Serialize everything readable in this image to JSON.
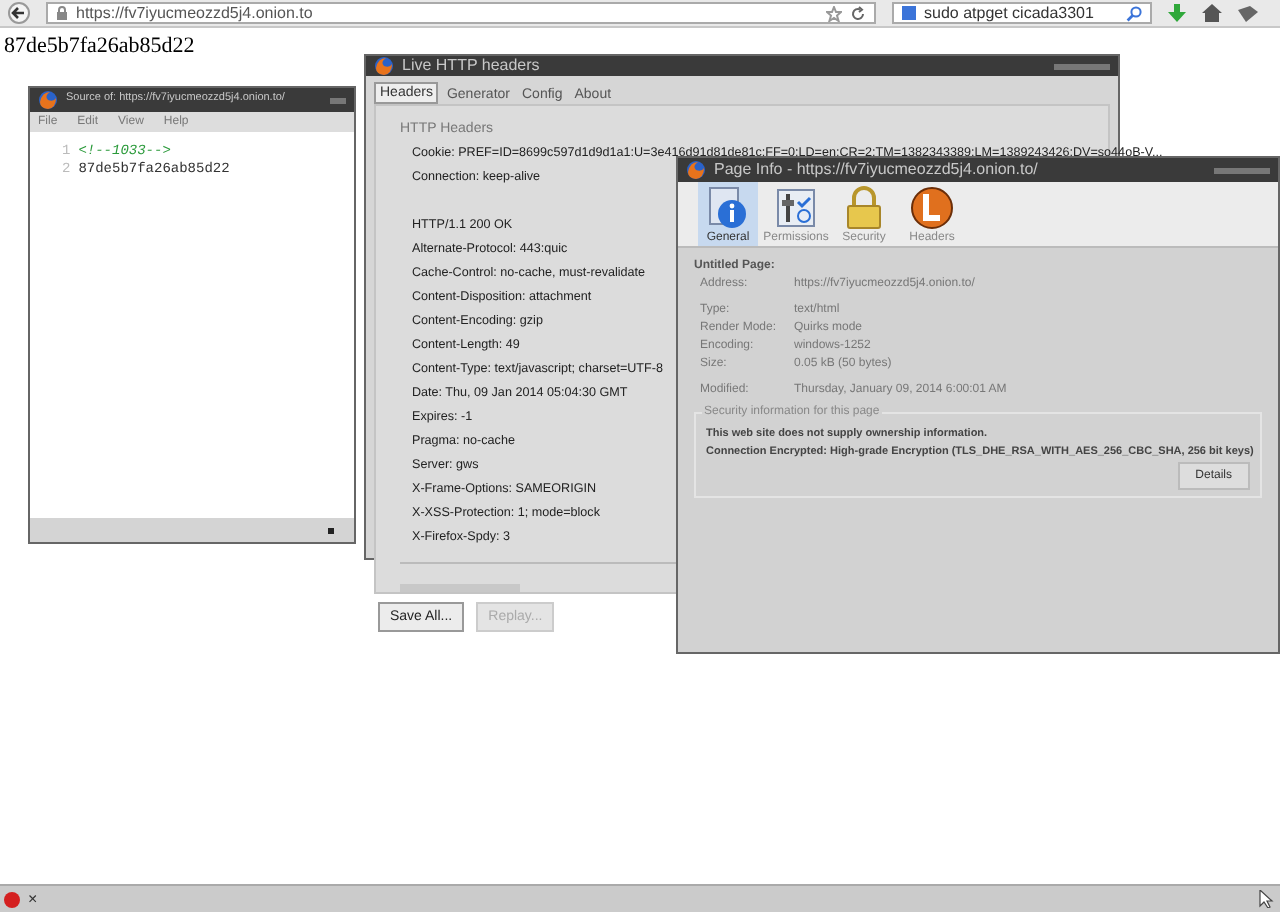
{
  "browser": {
    "url": "https://fv7iyucmeozzd5j4.onion.to",
    "search": "sudo atpget cicada3301"
  },
  "page_text": "87de5b7fa26ab85d22",
  "source_window": {
    "title": "Source of: https://fv7iyucmeozzd5j4.onion.to/",
    "menu": [
      "File",
      "Edit",
      "View",
      "Help"
    ],
    "lines": [
      {
        "number": "1",
        "text": "<!--1033-->",
        "kind": "comment"
      },
      {
        "number": "2",
        "text": "87de5b7fa26ab85d22",
        "kind": "text"
      }
    ]
  },
  "headers_window": {
    "title": "Live HTTP headers",
    "tabs": [
      {
        "label": "Headers",
        "selected": true
      },
      {
        "label": "Generator",
        "selected": false
      },
      {
        "label": "Config",
        "selected": false
      },
      {
        "label": "About",
        "selected": false
      }
    ],
    "section": "HTTP Headers",
    "lines": [
      {
        "text": "Cookie: PREF=ID=8699c597d1d9d1a1:U=3e416d91d81de81c:FF=0:LD=en:CR=2:TM=1382343389:LM=1389243426:DV=so44oB-V...",
        "kind": "request"
      },
      {
        "text": "Connection: keep-alive",
        "kind": "request"
      },
      {
        "text": "HTTP/1.1 200 OK",
        "kind": "status"
      },
      {
        "text": "Alternate-Protocol: 443:quic",
        "kind": "response"
      },
      {
        "text": "Cache-Control: no-cache, must-revalidate",
        "kind": "response"
      },
      {
        "text": "Content-Disposition: attachment",
        "kind": "response"
      },
      {
        "text": "Content-Encoding: gzip",
        "kind": "response"
      },
      {
        "text": "Content-Length: 49",
        "kind": "response"
      },
      {
        "text": "Content-Type: text/javascript; charset=UTF-8",
        "kind": "response"
      },
      {
        "text": "Date: Thu, 09 Jan 2014 05:04:30 GMT",
        "kind": "response"
      },
      {
        "text": "Expires: -1",
        "kind": "response"
      },
      {
        "text": "Pragma: no-cache",
        "kind": "response"
      },
      {
        "text": "Server: gws",
        "kind": "response"
      },
      {
        "text": "X-Frame-Options: SAMEORIGIN",
        "kind": "response"
      },
      {
        "text": "X-XSS-Protection: 1; mode=block",
        "kind": "response"
      },
      {
        "text": "X-Firefox-Spdy: 3",
        "kind": "response"
      }
    ],
    "buttons": [
      {
        "label": "Save All...",
        "disabled": false
      },
      {
        "label": "Replay...",
        "disabled": true
      }
    ]
  },
  "page_info": {
    "title": "Page Info - https://fv7iyucmeozzd5j4.onion.to/",
    "tabs": [
      {
        "label": "General",
        "kind": "info",
        "selected": true
      },
      {
        "label": "Permissions",
        "kind": "permissions",
        "selected": false
      },
      {
        "label": "Security",
        "kind": "lock",
        "selected": false
      },
      {
        "label": "Headers",
        "kind": "headers",
        "selected": false
      }
    ],
    "page_title": "Untitled Page:",
    "field_groups": [
      [
        {
          "label": "Address:",
          "value": "https://fv7iyucmeozzd5j4.onion.to/"
        }
      ],
      [
        {
          "label": "Type:",
          "value": "text/html"
        },
        {
          "label": "Render Mode:",
          "value": "Quirks mode"
        },
        {
          "label": "Encoding:",
          "value": "windows-1252"
        },
        {
          "label": "Size:",
          "value": "0.05 kB (50 bytes)"
        }
      ],
      [
        {
          "label": "Modified:",
          "value": "Thursday, January 09, 2014 6:00:01 AM"
        }
      ]
    ],
    "security_heading": "Security information for this page",
    "security_lines": [
      "This web site does not supply ownership information.",
      "Connection Encrypted: High-grade Encryption (TLS_DHE_RSA_WITH_AES_256_CBC_SHA, 256 bit keys)"
    ],
    "details_button": "Details"
  },
  "status_bar": {
    "close": "×"
  }
}
